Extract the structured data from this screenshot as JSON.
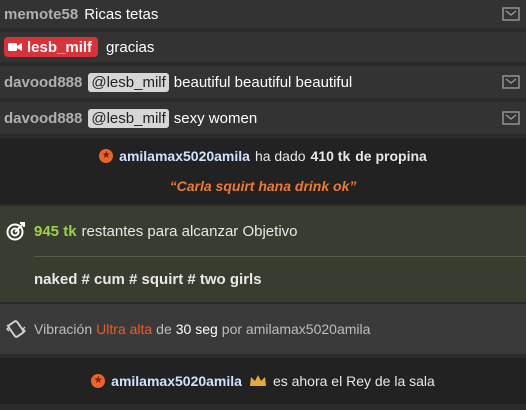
{
  "chat": [
    {
      "user": "memote58",
      "message": "Ricas tetas"
    },
    {
      "badge": "lesb_milf",
      "message": "gracias"
    },
    {
      "user": "davood888",
      "mention": "@lesb_milf",
      "message": "beautiful beautiful beautiful"
    },
    {
      "user": "davood888",
      "mention": "@lesb_milf",
      "message": "sexy women"
    }
  ],
  "tip": {
    "user": "amilamax5020amila",
    "text_before": "ha dado",
    "amount": "410 tk",
    "text_after": "de propina",
    "message": "“Carla squirt hana drink ok”"
  },
  "goal": {
    "amount": "945 tk",
    "text": "restantes para alcanzar Objetivo",
    "tags": "naked # cum # squirt # two girls"
  },
  "vibration": {
    "label": "Vibración",
    "level": "Ultra alta",
    "of": "de",
    "seconds": "30 seg",
    "by": "por amilamax5020amila"
  },
  "king": {
    "user": "amilamax5020amila",
    "text": "es ahora el Rey de la sala"
  },
  "colors": {
    "host_badge": "#d9333a",
    "goal_amount": "#9ad24a",
    "tip_message": "#f07a2c",
    "vibration_level": "#f05a2a"
  },
  "icons": [
    "report-flag-icon",
    "camera-icon",
    "star-icon",
    "target-icon",
    "vibration-icon",
    "crown-icon"
  ]
}
